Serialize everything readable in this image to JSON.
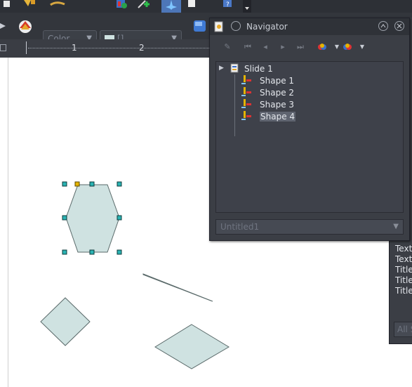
{
  "toolbar": {
    "line_color_placeholder": "Color",
    "fill_color_label": "[]"
  },
  "ruler": {
    "numbers": [
      "1",
      "2"
    ]
  },
  "navigator": {
    "title": "Navigator",
    "tree": [
      {
        "label": "Slide 1",
        "level": 0,
        "expanded": true,
        "selected": false
      },
      {
        "label": "Shape 1",
        "level": 1,
        "selected": false
      },
      {
        "label": "Shape 2",
        "level": 1,
        "selected": false
      },
      {
        "label": "Shape 3",
        "level": 1,
        "selected": false
      },
      {
        "label": "Shape 4",
        "level": 1,
        "selected": true
      }
    ],
    "document_select": "Untitled1"
  },
  "panel2": {
    "items": [
      "Text",
      "Text",
      "Title",
      "Title",
      "Title"
    ],
    "search_placeholder": "All S"
  },
  "colors": {
    "shape_fill": "#cfe2e1",
    "shape_stroke": "#5a6a6a",
    "handle": "#2ab3b3",
    "dark_ui": "#3b3e45"
  }
}
